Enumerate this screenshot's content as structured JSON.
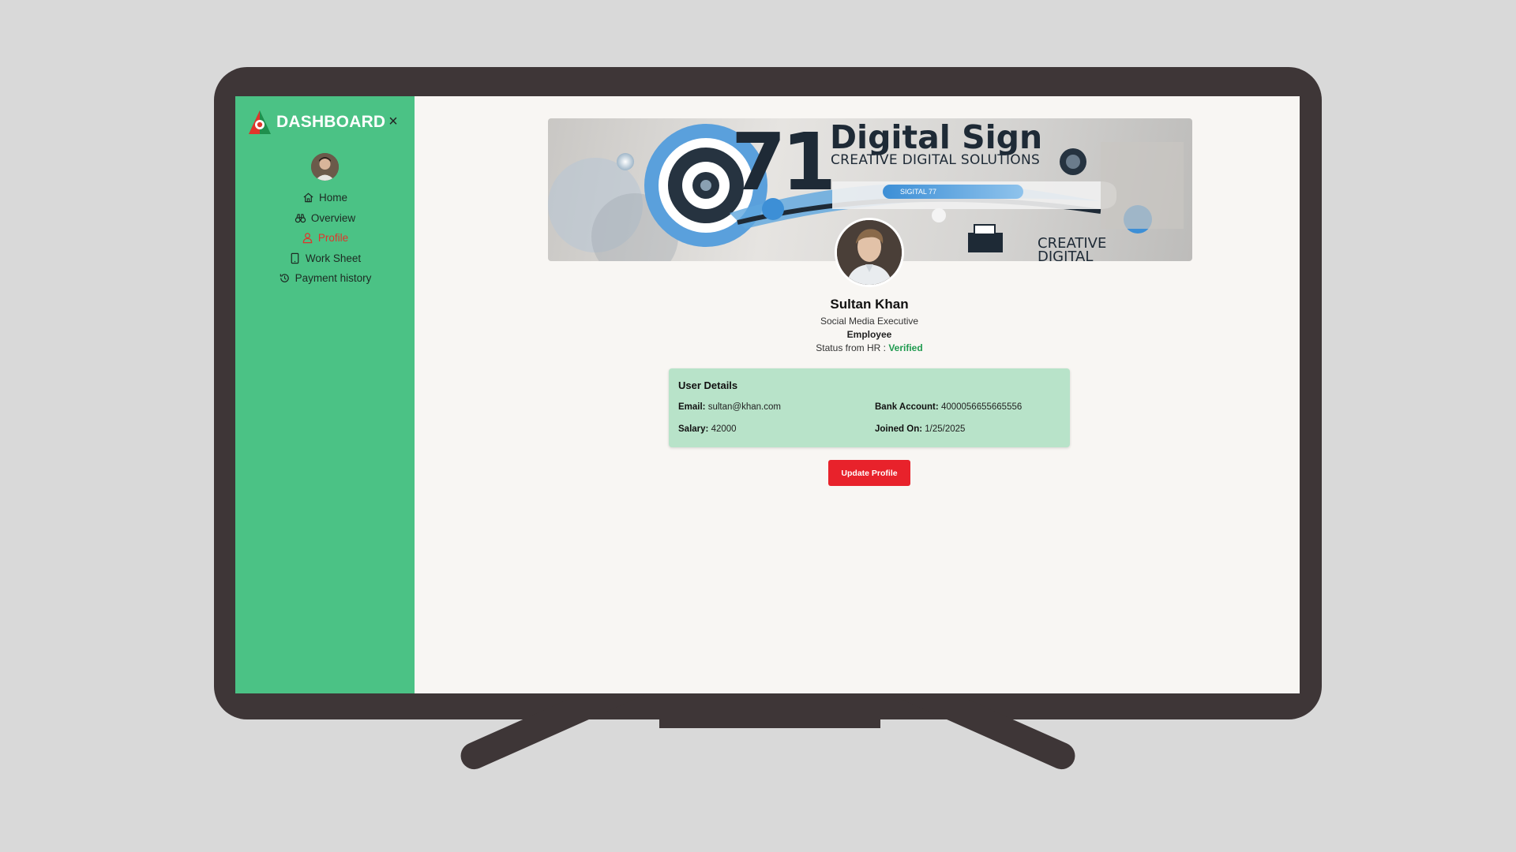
{
  "sidebar": {
    "title": "DASHBOARD",
    "close_label": "×",
    "items": [
      {
        "label": "Home",
        "icon": "home-icon"
      },
      {
        "label": "Overview",
        "icon": "binoculars-icon"
      },
      {
        "label": "Profile",
        "icon": "user-icon",
        "active": true
      },
      {
        "label": "Work Sheet",
        "icon": "tablet-icon"
      },
      {
        "label": "Payment history",
        "icon": "history-icon"
      }
    ]
  },
  "banner": {
    "number": "71",
    "title": "Digital Sign",
    "subtitle": "CREATIVE DIGITAL SOLUTIONS",
    "pill_text": "SIGITAL 77",
    "corner_text": "CREATIVE DIGITAL"
  },
  "profile": {
    "name": "Sultan Khan",
    "designation": "Social Media Executive",
    "role": "Employee",
    "status_label": "Status from HR :",
    "status_value": "Verified"
  },
  "details": {
    "title": "User Details",
    "email_label": "Email:",
    "email": "sultan@khan.com",
    "bank_label": "Bank Account:",
    "bank": "4000056655665556",
    "salary_label": "Salary:",
    "salary": "42000",
    "joined_label": "Joined On:",
    "joined": "1/25/2025"
  },
  "actions": {
    "update_label": "Update Profile"
  },
  "colors": {
    "sidebar_bg": "#4bc285",
    "active_nav": "#e0352b",
    "details_bg": "#b8e3c9",
    "button_bg": "#e8222b",
    "verified": "#1f9a4f",
    "monitor_frame": "#3e3637"
  }
}
